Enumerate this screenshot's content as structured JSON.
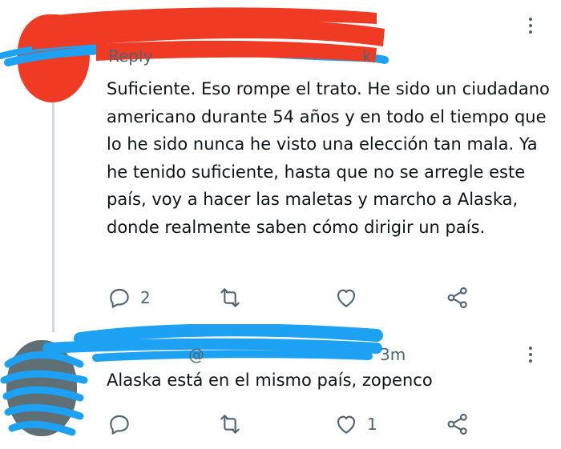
{
  "tweets": [
    {
      "header_peek_left": "Reply",
      "header_peek_right": "k",
      "text": "Suficiente. Eso rompe el trato. He sido un ciudadano americano durante 54 años y en todo el tiempo que lo he sido nunca he visto una elección tan mala. Ya he tenido suficiente, hasta que no se arregle este país, voy a hacer las maletas y marcho a Alaska, donde realmente saben cómo dirigir un país.",
      "reply_count": "2",
      "retweet_count": "",
      "like_count": "",
      "redaction_color": "#ef3b24"
    },
    {
      "header_peek_left": "@",
      "header_peek_right": "3m",
      "text": "Alaska está en el mismo país, zopenco",
      "reply_count": "",
      "retweet_count": "",
      "like_count": "1",
      "redaction_color": "#1da1f2"
    }
  ],
  "icons": {
    "reply": "reply-icon",
    "retweet": "retweet-icon",
    "like": "heart-icon",
    "share": "share-icon",
    "more": "more-icon"
  },
  "colors": {
    "text": "#0f1419",
    "muted": "#536471",
    "thread_line": "#cfd9de",
    "blue_scribble": "#1da1f2",
    "red_scribble": "#ef3b24"
  }
}
